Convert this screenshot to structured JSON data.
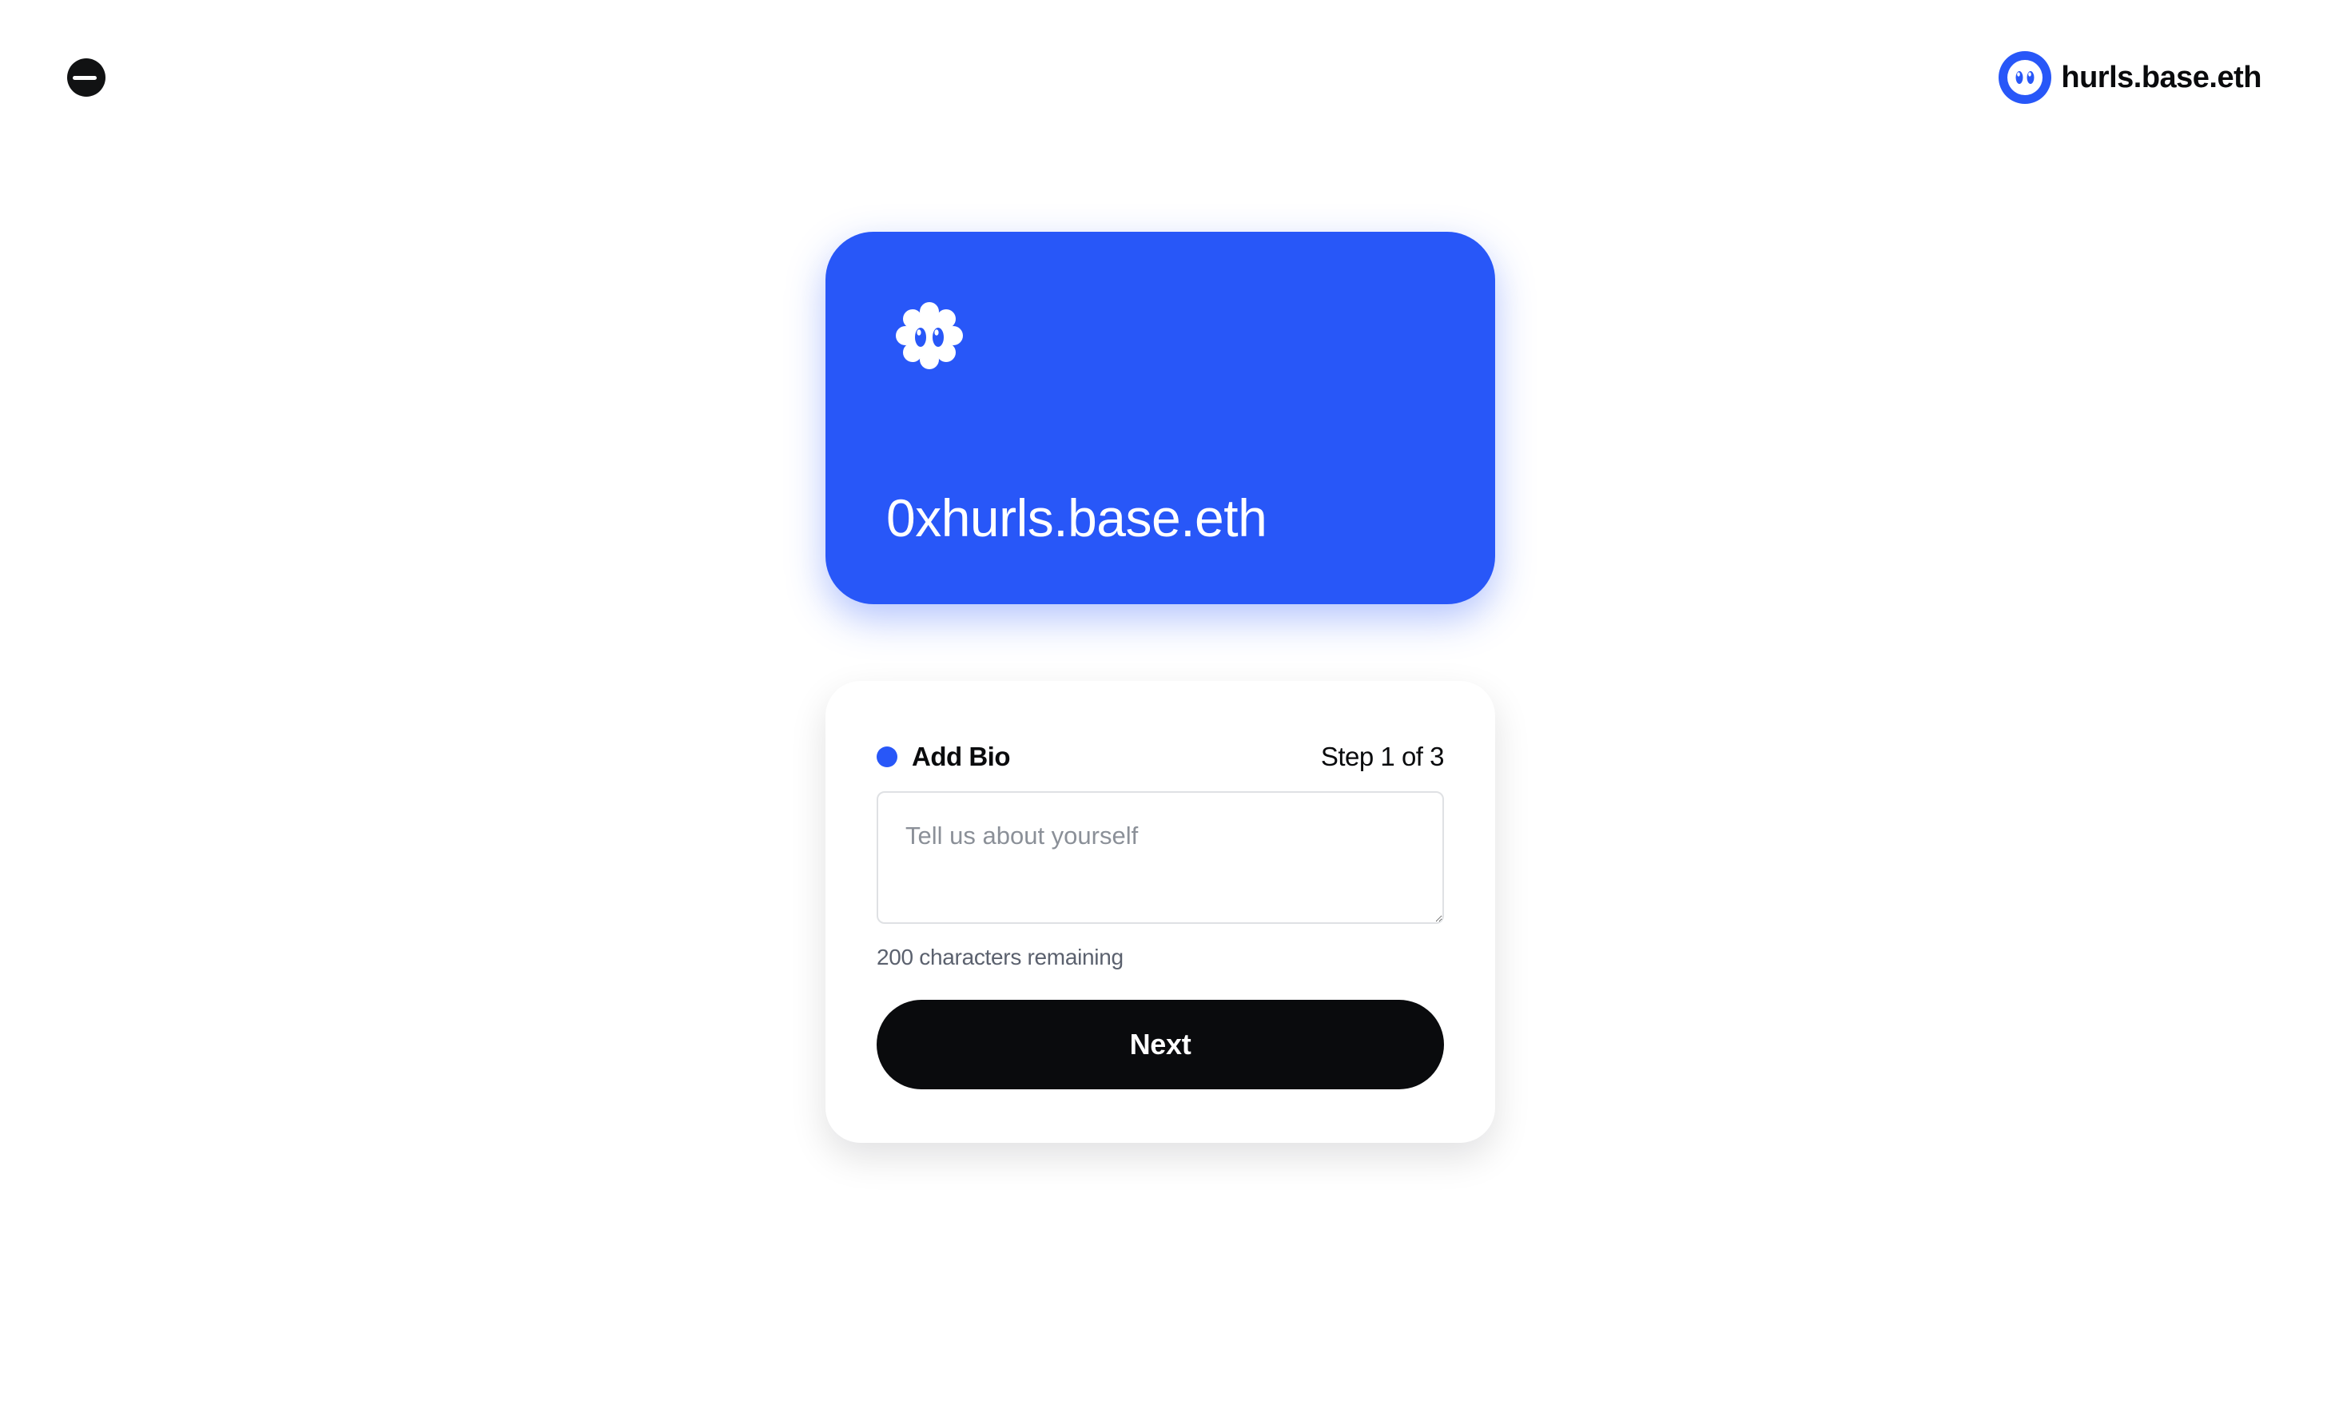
{
  "header": {
    "logo_icon": "base-logo-icon",
    "account": {
      "name": "hurls.base.eth",
      "avatar_icon": "basename-face-icon"
    }
  },
  "card": {
    "emblem_icon": "basename-face-icon",
    "name": "0xhurls.base.eth"
  },
  "bio_step": {
    "title": "Add Bio",
    "step": "Step 1 of 3",
    "input": {
      "value": "",
      "placeholder": "Tell us about yourself"
    },
    "char_count": "200 characters remaining",
    "next_label": "Next"
  },
  "colors": {
    "accent": "#2857f8",
    "dark": "#0a0b0d",
    "muted": "#5b616e"
  }
}
